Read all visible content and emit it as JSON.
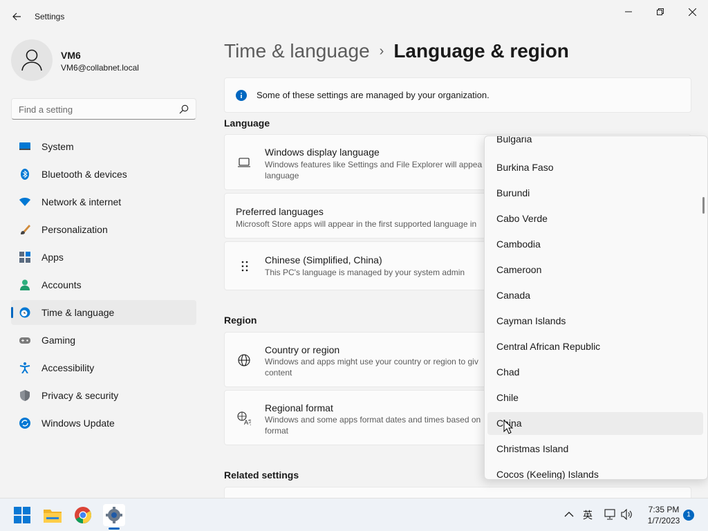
{
  "window": {
    "title": "Settings"
  },
  "profile": {
    "name": "VM6",
    "email": "VM6@collabnet.local"
  },
  "search": {
    "placeholder": "Find a setting"
  },
  "nav": {
    "items": [
      {
        "label": "System",
        "icon": "system-icon"
      },
      {
        "label": "Bluetooth & devices",
        "icon": "bluetooth-icon"
      },
      {
        "label": "Network & internet",
        "icon": "wifi-icon"
      },
      {
        "label": "Personalization",
        "icon": "brush-icon"
      },
      {
        "label": "Apps",
        "icon": "apps-icon"
      },
      {
        "label": "Accounts",
        "icon": "person-icon"
      },
      {
        "label": "Time & language",
        "icon": "globe-clock-icon",
        "active": true
      },
      {
        "label": "Gaming",
        "icon": "gamepad-icon"
      },
      {
        "label": "Accessibility",
        "icon": "accessibility-icon"
      },
      {
        "label": "Privacy & security",
        "icon": "shield-icon"
      },
      {
        "label": "Windows Update",
        "icon": "update-icon"
      }
    ]
  },
  "breadcrumb": {
    "parent": "Time & language",
    "separator": "›",
    "current": "Language & region"
  },
  "info_bar": {
    "text": "Some of these settings are managed by your organization.",
    "color": "#0067c0"
  },
  "language_section": {
    "title": "Language",
    "display_language": {
      "title": "Windows display language",
      "desc_line1": "Windows features like Settings and File Explorer will appea",
      "desc_line2": "language"
    },
    "preferred": {
      "title": "Preferred languages",
      "desc": "Microsoft Store apps will appear in the first supported language in"
    },
    "installed": {
      "title": "Chinese (Simplified, China)",
      "desc": "This PC's language is managed by your system admin"
    }
  },
  "region_section": {
    "title": "Region",
    "country": {
      "title": "Country or region",
      "desc_line1": "Windows and apps might use your country or region to giv",
      "desc_line2": "content"
    },
    "format": {
      "title": "Regional format",
      "desc_line1": "Windows and some apps format dates and times based on",
      "desc_line2": "format"
    }
  },
  "related": {
    "title": "Related settings"
  },
  "dropdown": {
    "items": [
      "Bulgaria",
      "Burkina Faso",
      "Burundi",
      "Cabo Verde",
      "Cambodia",
      "Cameroon",
      "Canada",
      "Cayman Islands",
      "Central African Republic",
      "Chad",
      "Chile",
      "China",
      "Christmas Island",
      "Cocos (Keeling) Islands"
    ],
    "hovered": "China"
  },
  "taskbar": {
    "ime": "英",
    "time": "7:35 PM",
    "date": "1/7/2023",
    "notifications": "1",
    "accent": "#0067c0"
  }
}
